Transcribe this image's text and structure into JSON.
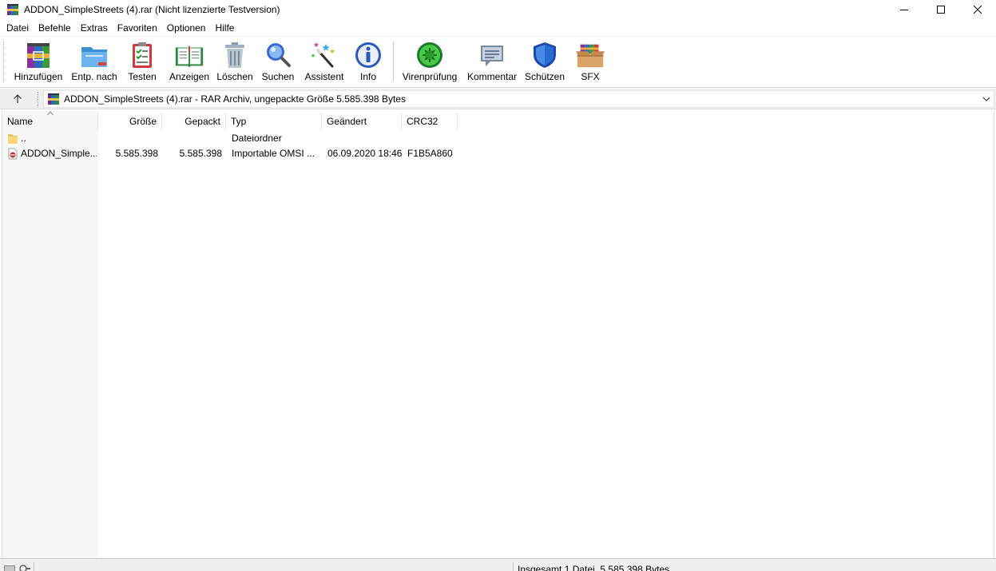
{
  "window": {
    "title": "ADDON_SimpleStreets (4).rar (Nicht lizenzierte Testversion)",
    "controls": [
      "minimize-icon",
      "maximize-icon",
      "close-icon"
    ]
  },
  "menu": [
    "Datei",
    "Befehle",
    "Extras",
    "Favoriten",
    "Optionen",
    "Hilfe"
  ],
  "toolbar": {
    "buttons": [
      {
        "label": "Hinzufügen",
        "icon": "add-archive-icon"
      },
      {
        "label": "Entp. nach",
        "icon": "extract-folder-icon"
      },
      {
        "label": "Testen",
        "icon": "test-checklist-icon"
      },
      {
        "label": "Anzeigen",
        "icon": "view-book-icon"
      },
      {
        "label": "Löschen",
        "icon": "trash-icon"
      },
      {
        "label": "Suchen",
        "icon": "search-icon"
      },
      {
        "label": "Assistent",
        "icon": "wizard-wand-icon"
      },
      {
        "label": "Info",
        "icon": "info-icon"
      },
      {
        "label": "Virenprüfung",
        "icon": "virus-scan-icon"
      },
      {
        "label": "Kommentar",
        "icon": "comment-icon"
      },
      {
        "label": "Schützen",
        "icon": "shield-icon"
      },
      {
        "label": "SFX",
        "icon": "sfx-box-icon"
      }
    ]
  },
  "address": {
    "text": "ADDON_SimpleStreets (4).rar - RAR Archiv, ungepackte Größe 5.585.398 Bytes"
  },
  "table": {
    "columns": [
      "Name",
      "Größe",
      "Gepackt",
      "Typ",
      "Geändert",
      "CRC32"
    ],
    "rows": [
      {
        "name": "..",
        "size": "",
        "packed": "",
        "type": "Dateiordner",
        "modified": "",
        "crc": "",
        "icon": "folder-icon"
      },
      {
        "name": "ADDON_Simple...",
        "size": "5.585.398",
        "packed": "5.585.398",
        "type": "Importable OMSI ...",
        "modified": "06.09.2020 18:46",
        "crc": "F1B5A860",
        "icon": "omsi-file-icon"
      }
    ]
  },
  "status": {
    "text": "Insgesamt 1 Datei, 5.585.398 Bytes"
  }
}
